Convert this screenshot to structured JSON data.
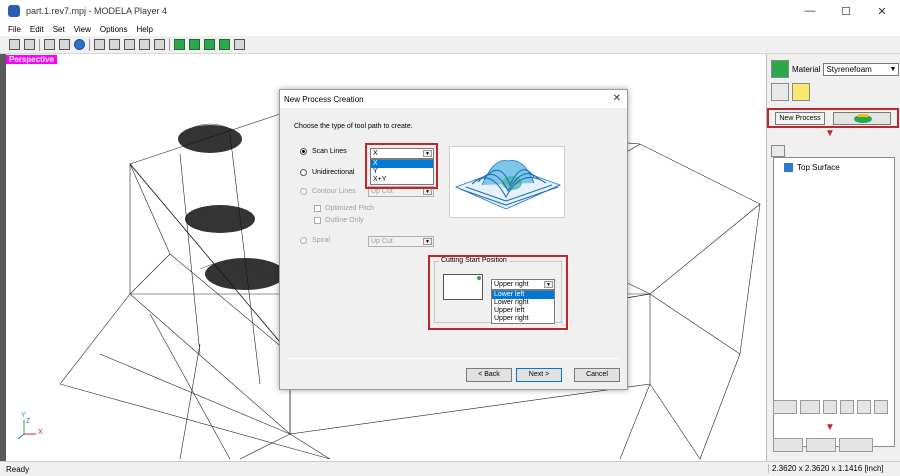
{
  "window": {
    "title": "part.1.rev7.mpj - MODELA Player 4",
    "controls": {
      "minimize": "—",
      "maximize": "☐",
      "close": "✕"
    }
  },
  "menu": [
    "File",
    "Edit",
    "Set",
    "View",
    "Options",
    "Help"
  ],
  "viewport": {
    "label": "Perspective",
    "axis_y": "Y",
    "axis_x": "X",
    "axis_z": "Z"
  },
  "right_panel": {
    "material_label": "Material",
    "material_value": "Styrenefoam",
    "new_process_label": "New Process",
    "tree_items": [
      "Top Surface"
    ]
  },
  "dialog": {
    "title": "New Process Creation",
    "close": "✕",
    "prompt": "Choose the type of tool path to create.",
    "options": {
      "scan_lines": "Scan Lines",
      "unidirectional": "Unidirectional",
      "contour_lines": "Contour Lines",
      "optimized_pitch": "Optimized Pitch",
      "outline_only": "Outline Only",
      "spiral": "Spiral"
    },
    "scan_lines_value": "X",
    "scan_lines_options": [
      "X",
      "Y",
      "X+Y"
    ],
    "scan_lines_selected_index": 0,
    "contour_value": "Up Cut",
    "spiral_value": "Up Cut",
    "cutting_start": {
      "group_label": "Cutting Start Position",
      "value": "Upper right",
      "options": [
        "Lower left",
        "Lower right",
        "Upper left",
        "Upper right"
      ],
      "selected_index": 0
    },
    "buttons": {
      "back": "< Back",
      "next": "Next >",
      "cancel": "Cancel"
    }
  },
  "status": {
    "left": "Ready",
    "right": "2.3620 x 2.3620 x 1.1416 [inch]"
  }
}
